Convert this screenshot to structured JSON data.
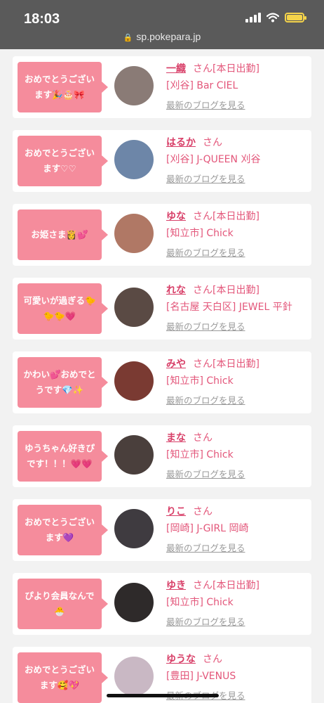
{
  "status": {
    "time": "18:03",
    "url": "sp.pokepara.jp"
  },
  "cards": [
    {
      "message": "おめでとうございます🎉🎂🎀",
      "name": "一織",
      "honorific": "さん",
      "status": "[本日出勤]",
      "shop": "[刈谷] Bar CIEL",
      "blog_link": "最新のブログを見る",
      "avatar_color": "#8a7b76"
    },
    {
      "message": "おめでとうございます♡♡",
      "name": "はるか",
      "honorific": "さん",
      "status": "",
      "shop": "[刈谷] J-QUEEN 刈谷",
      "blog_link": "最新のブログを見る",
      "avatar_color": "#6d86a8"
    },
    {
      "message": "お姫さま👸💕",
      "name": "ゆな",
      "honorific": "さん",
      "status": "[本日出勤]",
      "shop": "[知立市] Chick",
      "blog_link": "最新のブログを見る",
      "avatar_color": "#b07865"
    },
    {
      "message": "可愛いが過ぎる🐤🐤🐤💗",
      "name": "れな",
      "honorific": "さん",
      "status": "[本日出勤]",
      "shop": "[名古屋 天白区] JEWEL 平針",
      "blog_link": "最新のブログを見る",
      "avatar_color": "#5a4a44"
    },
    {
      "message": "かわい💕おめでとうです💎✨",
      "name": "みや",
      "honorific": "さん",
      "status": "[本日出勤]",
      "shop": "[知立市] Chick",
      "blog_link": "最新のブログを見る",
      "avatar_color": "#7a3a32"
    },
    {
      "message": "ゆうちゃん好きぴです！！！💗💗",
      "name": "まな",
      "honorific": "さん",
      "status": "",
      "shop": "[知立市] Chick",
      "blog_link": "最新のブログを見る",
      "avatar_color": "#4a3f3c"
    },
    {
      "message": "おめでとうございます💜",
      "name": "りこ",
      "honorific": "さん",
      "status": "",
      "shop": "[岡崎] J-GIRL 岡崎",
      "blog_link": "最新のブログを見る",
      "avatar_color": "#3f3b40"
    },
    {
      "message": "ぴより会員なんで🐣",
      "name": "ゆき",
      "honorific": "さん",
      "status": "[本日出勤]",
      "shop": "[知立市] Chick",
      "blog_link": "最新のブログを見る",
      "avatar_color": "#2e2a2a"
    },
    {
      "message": "おめでとうございます🥰💖",
      "name": "ゆうな",
      "honorific": "さん",
      "status": "",
      "shop": "[豊田] J-VENUS",
      "blog_link": "最新のブログを見る",
      "avatar_color": "#c9b8c4"
    }
  ]
}
